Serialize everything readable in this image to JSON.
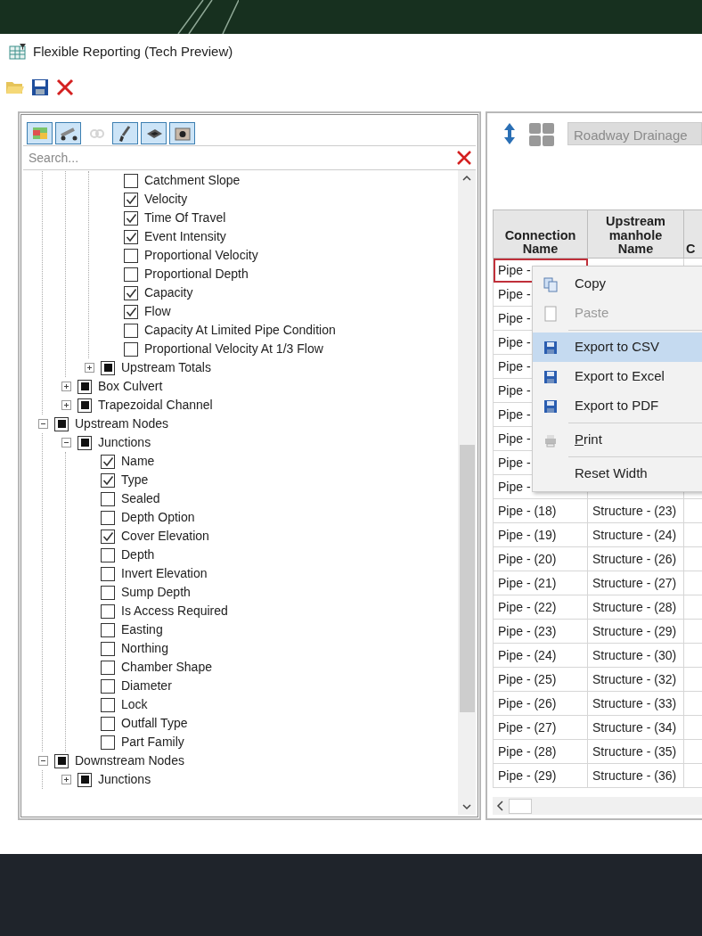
{
  "window": {
    "title": "Flexible Reporting (Tech Preview)"
  },
  "filter_buttons": [
    {
      "kind": "map",
      "selected": true,
      "disabled": false
    },
    {
      "kind": "pipe",
      "selected": true,
      "disabled": false
    },
    {
      "kind": "chain",
      "selected": false,
      "disabled": true
    },
    {
      "kind": "brush",
      "selected": true,
      "disabled": false
    },
    {
      "kind": "plate",
      "selected": true,
      "disabled": false
    },
    {
      "kind": "camera",
      "selected": true,
      "disabled": false
    }
  ],
  "search": {
    "placeholder": "Search..."
  },
  "tree": [
    {
      "children": [
        {
          "children": [
            {
              "children": [
                {
                  "label": "Catchment Slope",
                  "checked": false
                },
                {
                  "label": "Velocity",
                  "checked": true
                },
                {
                  "label": "Time Of Travel",
                  "checked": true
                },
                {
                  "label": "Event Intensity",
                  "checked": true
                },
                {
                  "label": "Proportional Velocity",
                  "checked": false
                },
                {
                  "label": "Proportional Depth",
                  "checked": false
                },
                {
                  "label": "Capacity",
                  "checked": true
                },
                {
                  "label": "Flow",
                  "checked": true
                },
                {
                  "label": "Capacity At Limited Pipe Condition",
                  "checked": false
                },
                {
                  "label": "Proportional Velocity At 1/3 Flow",
                  "checked": false
                }
              ]
            },
            {
              "label": "Upstream Totals",
              "partial": true,
              "expanded": false
            }
          ]
        },
        {
          "label": "Box Culvert",
          "partial": true,
          "expanded": false
        },
        {
          "label": "Trapezoidal Channel",
          "partial": true,
          "expanded": false
        }
      ]
    },
    {
      "label": "Upstream Nodes",
      "partial": true,
      "expanded": true,
      "children": [
        {
          "label": "Junctions",
          "partial": true,
          "expanded": true,
          "children": [
            {
              "label": "Name",
              "checked": true
            },
            {
              "label": "Type",
              "checked": true
            },
            {
              "label": "Sealed",
              "checked": false
            },
            {
              "label": "Depth Option",
              "checked": false
            },
            {
              "label": "Cover Elevation",
              "checked": true
            },
            {
              "label": "Depth",
              "checked": false
            },
            {
              "label": "Invert Elevation",
              "checked": false
            },
            {
              "label": "Sump Depth",
              "checked": false
            },
            {
              "label": "Is Access Required",
              "checked": false
            },
            {
              "label": "Easting",
              "checked": false
            },
            {
              "label": "Northing",
              "checked": false
            },
            {
              "label": "Chamber Shape",
              "checked": false
            },
            {
              "label": "Diameter",
              "checked": false
            },
            {
              "label": "Lock",
              "checked": false
            },
            {
              "label": "Outfall Type",
              "checked": false
            },
            {
              "label": "Part Family",
              "checked": false
            }
          ]
        }
      ]
    },
    {
      "label": "Downstream Nodes",
      "partial": true,
      "expanded": true,
      "children": [
        {
          "label": "Junctions",
          "partial": true,
          "expanded": false
        }
      ]
    }
  ],
  "project_select": {
    "value": "Roadway Drainage",
    "disabled": true
  },
  "table": {
    "columns": [
      {
        "label": "Connection Name"
      },
      {
        "label": "Upstream manhole Name"
      },
      {
        "label": "C"
      }
    ],
    "rows": [
      {
        "cells": [
          "Pipe -"
        ],
        "selected": true
      },
      {
        "cells": [
          "Pipe -"
        ],
        "selected": false
      },
      {
        "cells": [
          "Pipe -"
        ],
        "selected": false
      },
      {
        "cells": [
          "Pipe -"
        ],
        "selected": false
      },
      {
        "cells": [
          "Pipe -"
        ],
        "selected": false
      },
      {
        "cells": [
          "Pipe -"
        ],
        "selected": false
      },
      {
        "cells": [
          "Pipe -"
        ],
        "selected": false
      },
      {
        "cells": [
          "Pipe -"
        ],
        "selected": false
      },
      {
        "cells": [
          "Pipe -"
        ],
        "selected": false
      },
      {
        "cells": [
          "Pipe -"
        ],
        "selected": false
      },
      {
        "cells": [
          "Pipe - (18)",
          "Structure - (23)"
        ],
        "selected": false
      },
      {
        "cells": [
          "Pipe - (19)",
          "Structure - (24)"
        ],
        "selected": false
      },
      {
        "cells": [
          "Pipe - (20)",
          "Structure - (26)"
        ],
        "selected": false
      },
      {
        "cells": [
          "Pipe - (21)",
          "Structure - (27)"
        ],
        "selected": false
      },
      {
        "cells": [
          "Pipe - (22)",
          "Structure - (28)"
        ],
        "selected": false
      },
      {
        "cells": [
          "Pipe - (23)",
          "Structure - (29)"
        ],
        "selected": false
      },
      {
        "cells": [
          "Pipe - (24)",
          "Structure - (30)"
        ],
        "selected": false
      },
      {
        "cells": [
          "Pipe - (25)",
          "Structure - (32)"
        ],
        "selected": false
      },
      {
        "cells": [
          "Pipe - (26)",
          "Structure - (33)"
        ],
        "selected": false
      },
      {
        "cells": [
          "Pipe - (27)",
          "Structure - (34)"
        ],
        "selected": false
      },
      {
        "cells": [
          "Pipe - (28)",
          "Structure - (35)"
        ],
        "selected": false
      },
      {
        "cells": [
          "Pipe - (29)",
          "Structure - (36)"
        ],
        "selected": false
      }
    ]
  },
  "context_menu": [
    {
      "kind": "command",
      "label": "Copy",
      "disabled": false,
      "selected": false
    },
    {
      "kind": "command",
      "label": "Paste",
      "disabled": true,
      "selected": false
    },
    {
      "kind": "separator"
    },
    {
      "kind": "command",
      "label": "Export to CSV",
      "disabled": false,
      "selected": true
    },
    {
      "kind": "command",
      "label": "Export to Excel",
      "disabled": false,
      "selected": false
    },
    {
      "kind": "command",
      "label": "Export to PDF",
      "disabled": false,
      "selected": false
    },
    {
      "kind": "separator"
    },
    {
      "kind": "command",
      "label": "Print",
      "disabled": false,
      "selected": false,
      "first_letter_underlined": true
    },
    {
      "kind": "separator"
    },
    {
      "kind": "command",
      "label": "Reset Width",
      "disabled": false,
      "selected": false
    }
  ]
}
